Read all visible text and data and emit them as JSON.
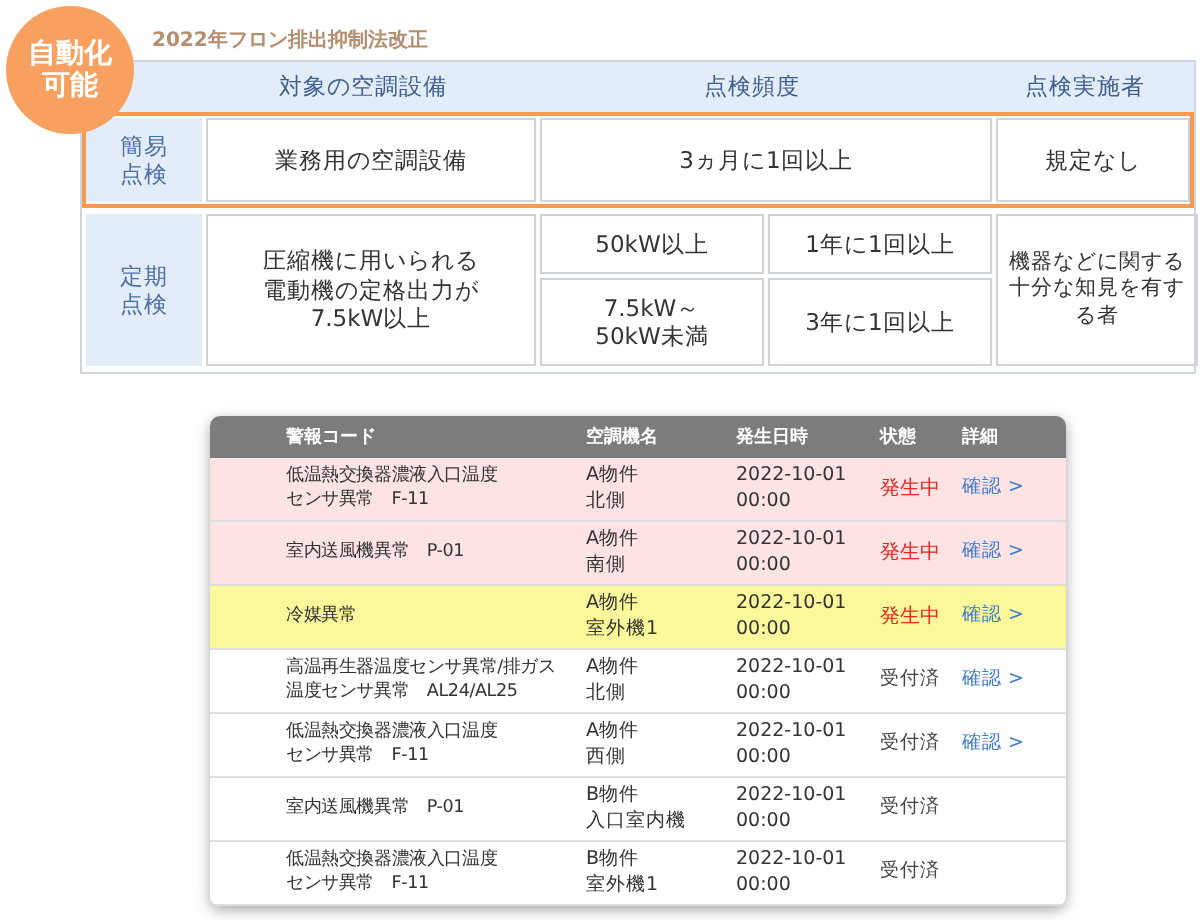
{
  "law_title": "2022年フロン排出抑制法改正",
  "badge": "自動化可能",
  "inspection_table": {
    "columns": [
      "対象の空調設備",
      "点検頻度",
      "点検実施者"
    ],
    "rows": [
      {
        "kind": "single",
        "label": "簡易点検",
        "highlighted": true,
        "equipment": "業務用の空調設備",
        "frequency": "3ヵ月に1回以上",
        "inspector": "規定なし"
      },
      {
        "kind": "tiered",
        "label": "定期点検",
        "highlighted": false,
        "equipment": "圧縮機に用いられる電動機の定格出力が7.5kW以上",
        "tiers": [
          {
            "output": "50kW以上",
            "frequency": "1年に1回以上"
          },
          {
            "output": "7.5kW～50kW未満",
            "frequency": "3年に1回以上"
          }
        ],
        "inspector": "機器などに関する十分な知見を有する者"
      }
    ]
  },
  "alerts": {
    "columns": [
      "警報コード",
      "空調機名",
      "発生日時",
      "状態",
      "詳細"
    ],
    "rows": [
      {
        "kind": "active",
        "color": "#fde3e4",
        "code": [
          "低温熱交換器濃液入口温度",
          "センサ異常　F-11"
        ],
        "unit": [
          "A物件",
          "北側"
        ],
        "time": "2022-10-01\n00:00",
        "status": "発生中",
        "link": "確認 >"
      },
      {
        "kind": "active",
        "color": "#fde3e4",
        "code": [
          "室内送風機異常　P-01"
        ],
        "unit": [
          "A物件",
          "南側"
        ],
        "time": "2022-10-01\n00:00",
        "status": "発生中",
        "link": "確認 >"
      },
      {
        "kind": "active",
        "color": "#fbf89c",
        "code": [
          "冷媒異常"
        ],
        "unit": [
          "A物件",
          "室外機1"
        ],
        "time": "2022-10-01\n00:00",
        "status": "発生中",
        "link": "確認 >"
      },
      {
        "kind": "received",
        "color": "#ffffff",
        "code": [
          "高温再生器温度センサ異常/排ガス",
          "温度センサ異常　AL24/AL25"
        ],
        "unit": [
          "A物件",
          "北側"
        ],
        "time": "2022-10-01\n00:00",
        "status": "受付済",
        "link": "確認 >"
      },
      {
        "kind": "received",
        "color": "#ffffff",
        "code": [
          "低温熱交換器濃液入口温度",
          "センサ異常　F-11"
        ],
        "unit": [
          "A物件",
          "西側"
        ],
        "time": "2022-10-01\n00:00",
        "status": "受付済",
        "link": "確認 >"
      },
      {
        "kind": "received",
        "color": "#ffffff",
        "code": [
          "室内送風機異常　P-01"
        ],
        "unit": [
          "B物件",
          "入口室内機"
        ],
        "time": "2022-10-01\n00:00",
        "status": "受付済"
      },
      {
        "kind": "received",
        "color": "#ffffff",
        "code": [
          "低温熱交換器濃液入口温度",
          "センサ異常　F-11"
        ],
        "unit": [
          "B物件",
          "室外機1"
        ],
        "time": "2022-10-01\n00:00",
        "status": "受付済"
      }
    ]
  }
}
